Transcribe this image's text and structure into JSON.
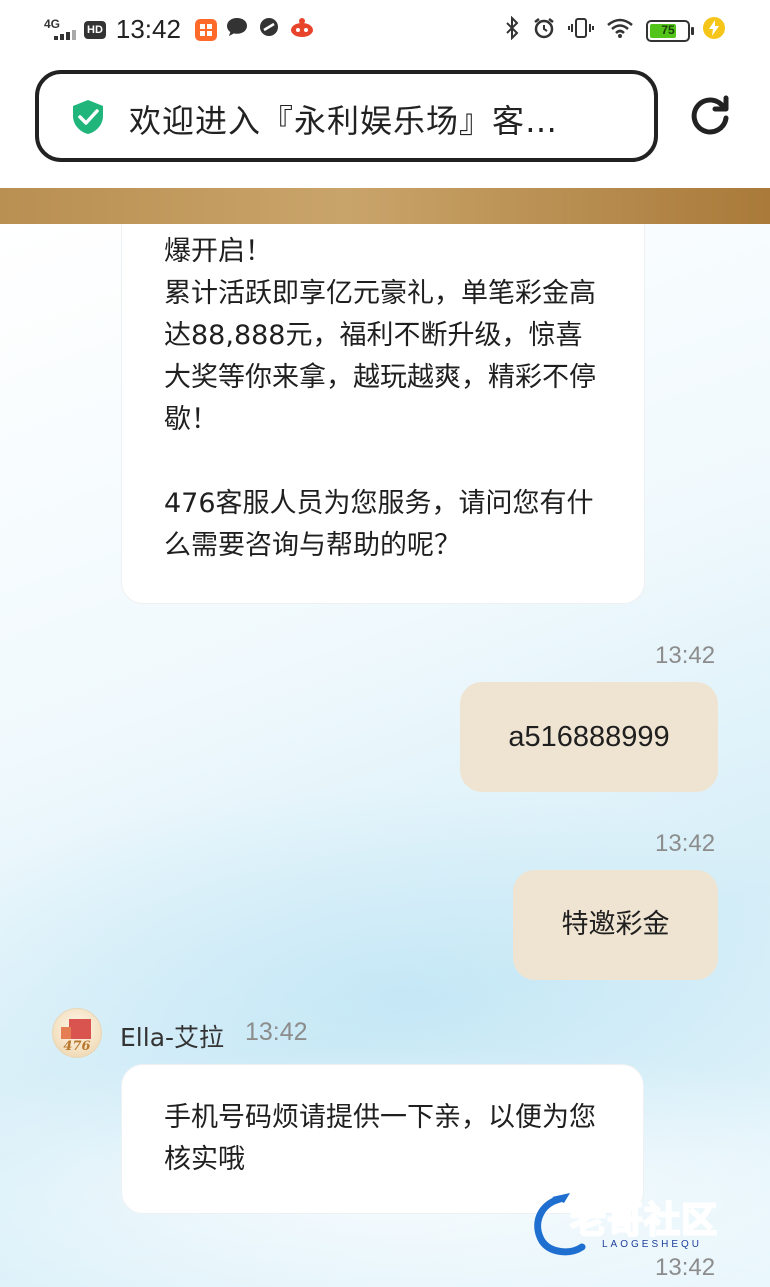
{
  "status_bar": {
    "network": "4G",
    "hd": "HD",
    "time": "13:42",
    "battery": "75",
    "battery_level": 0.75,
    "icons": [
      "bluetooth-icon",
      "alarm-icon",
      "vibrate-icon",
      "wifi-icon",
      "charging-icon"
    ]
  },
  "browser": {
    "page_title": "欢迎进入『永利娱乐场』客…",
    "secure_icon": "shield-check-icon",
    "reload_icon": "reload-icon"
  },
  "colors": {
    "gold_band": "#b98f52",
    "user_bubble": "#efe3d1",
    "shield": "#1fb57b"
  },
  "chat": {
    "messages": [
      {
        "side": "left",
        "text": "爆开启！\n累计活跃即享亿元豪礼，单笔彩金高达88,888元，福利不断升级，惊喜大奖等你来拿，越玩越爽，精彩不停歇！\n\n476客服人员为您服务，请问您有什么需要咨询与帮助的呢？"
      },
      {
        "side": "right",
        "time": "13:42",
        "text": "a516888999"
      },
      {
        "side": "right",
        "time": "13:42",
        "text": "特邀彩金"
      },
      {
        "side": "left",
        "sender": "Ella-艾拉",
        "avatar_label": "476",
        "time": "13:42",
        "text": "手机号码烦请提供一下亲，以便为您核实哦"
      }
    ],
    "bottom_time": "13:42"
  },
  "watermark": {
    "title": "老哥社区",
    "subtitle": "LAOGESHEQU"
  }
}
